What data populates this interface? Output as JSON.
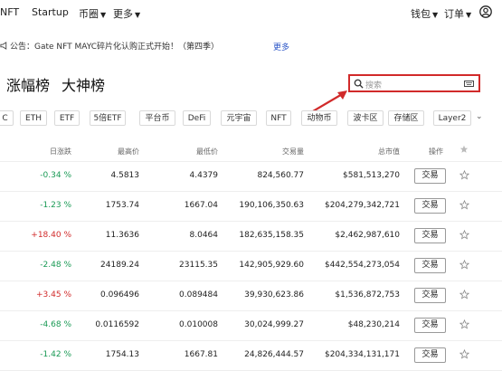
{
  "nav": {
    "items": [
      "NFT",
      "Startup",
      "币圈",
      "更多"
    ],
    "right": [
      "钱包",
      "订单"
    ],
    "dropdown_items": [
      "币圈",
      "更多",
      "钱包",
      "订单"
    ]
  },
  "notice": {
    "text": "公告：Gate NFT MAYC碎片化认购正式开始！（第四季）",
    "more": "更多"
  },
  "tabs": [
    "涨幅榜",
    "大神榜"
  ],
  "search": {
    "placeholder": "搜索"
  },
  "chips": [
    "C",
    "ETH",
    "ETF",
    "5倍ETF",
    "平台币",
    "DeFi",
    "元宇宙",
    "NFT",
    "动物币",
    "波卡区",
    "存储区",
    "Layer2"
  ],
  "columns": [
    "日涨跌",
    "最高价",
    "最低价",
    "交易量",
    "总市值",
    "操作"
  ],
  "rows": [
    {
      "change": "-0.34 %",
      "dir": "down",
      "high": "4.5813",
      "low": "4.4379",
      "volume": "824,560.77",
      "cap": "$581,513,270",
      "action": "交易"
    },
    {
      "change": "-1.23 %",
      "dir": "down",
      "high": "1753.74",
      "low": "1667.04",
      "volume": "190,106,350.63",
      "cap": "$204,279,342,721",
      "action": "交易"
    },
    {
      "change": "+18.40 %",
      "dir": "up",
      "high": "11.3636",
      "low": "8.0464",
      "volume": "182,635,158.35",
      "cap": "$2,462,987,610",
      "action": "交易"
    },
    {
      "change": "-2.48 %",
      "dir": "down",
      "high": "24189.24",
      "low": "23115.35",
      "volume": "142,905,929.60",
      "cap": "$442,554,273,054",
      "action": "交易"
    },
    {
      "change": "+3.45 %",
      "dir": "up",
      "high": "0.096496",
      "low": "0.089484",
      "volume": "39,930,623.86",
      "cap": "$1,536,872,753",
      "action": "交易"
    },
    {
      "change": "-4.68 %",
      "dir": "down",
      "high": "0.0116592",
      "low": "0.010008",
      "volume": "30,024,999.27",
      "cap": "$48,230,214",
      "action": "交易"
    },
    {
      "change": "-1.42 %",
      "dir": "down",
      "high": "1754.13",
      "low": "1667.81",
      "volume": "24,826,444.57",
      "cap": "$204,334,131,171",
      "action": "交易"
    }
  ],
  "colors": {
    "highlight": "#d12a2a",
    "up": "#d12a2a",
    "down": "#1a9a55",
    "link": "#2b55c7"
  }
}
